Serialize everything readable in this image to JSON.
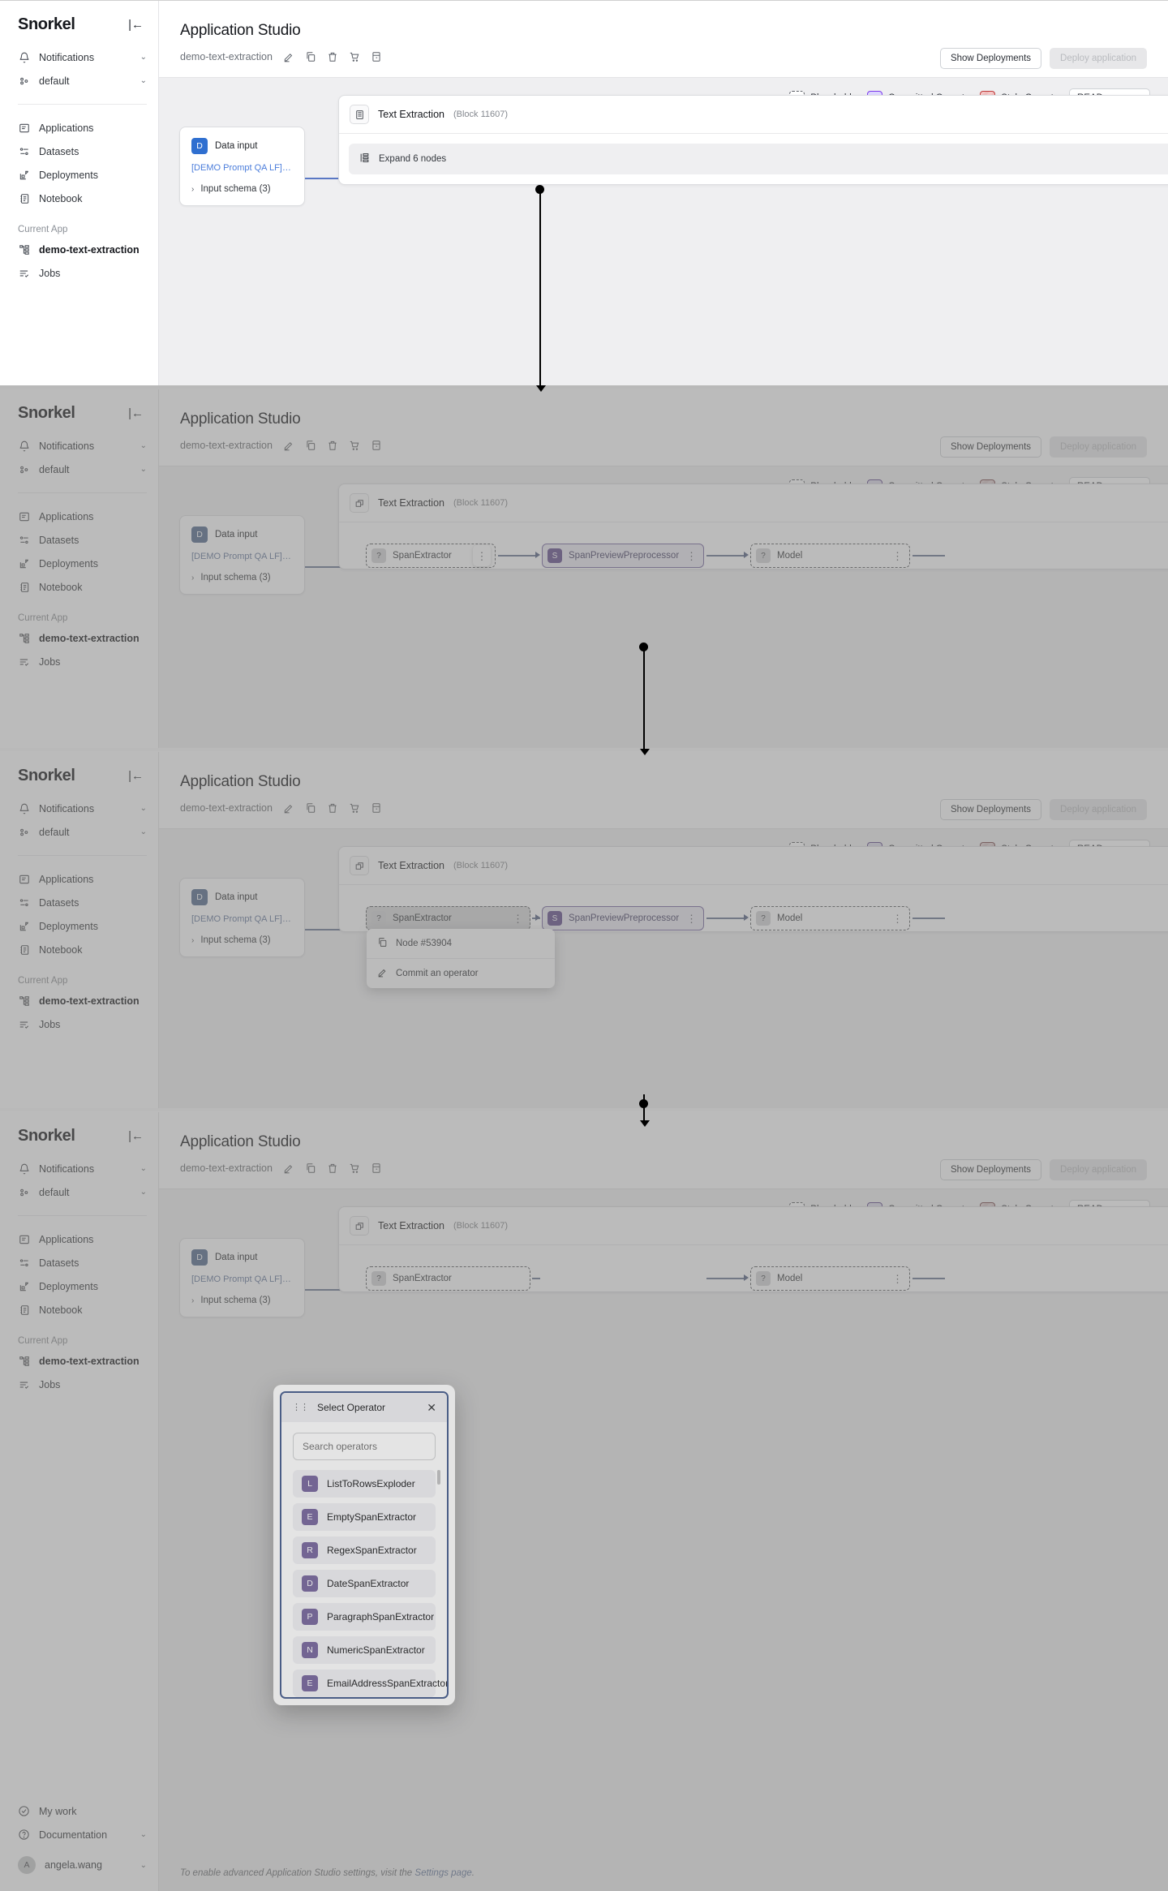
{
  "sidebar": {
    "logo": "Snorkel",
    "collapse_icon": "collapse-left-icon",
    "top_items": [
      {
        "label": "Notifications",
        "icon": "bell-icon",
        "chevron": "⌄"
      },
      {
        "label": "default",
        "icon": "workspace-icon",
        "chevron": "⌄"
      }
    ],
    "nav_items": [
      {
        "label": "Applications",
        "icon": "applications-icon"
      },
      {
        "label": "Datasets",
        "icon": "datasets-icon"
      },
      {
        "label": "Deployments",
        "icon": "deployments-icon"
      },
      {
        "label": "Notebook",
        "icon": "notebook-icon"
      }
    ],
    "current_app_caption": "Current App",
    "current_app_items": [
      {
        "label": "demo-text-extraction",
        "icon": "app-tree-icon",
        "active": true
      },
      {
        "label": "Jobs",
        "icon": "jobs-icon",
        "active": false
      }
    ],
    "bottom_items": [
      {
        "label": "My work",
        "icon": "check-circle-icon",
        "chevron": ""
      },
      {
        "label": "Documentation",
        "icon": "question-circle-icon",
        "chevron": "⌄"
      }
    ],
    "user": {
      "initial": "A",
      "name": "angela.wang",
      "chevron": "⌄"
    }
  },
  "header": {
    "title": "Application Studio",
    "app_name": "demo-text-extraction",
    "icons": [
      "edit-icon",
      "copy-icon",
      "trash-icon",
      "cart-icon",
      "archive-icon"
    ],
    "show_deployments_label": "Show Deployments",
    "deploy_label": "Deploy application"
  },
  "legend": {
    "placeholder": "Placeholder",
    "committed": "Committed Operator",
    "stale": "Stale Operator",
    "mode_value": "READ",
    "colors": {
      "committed_border": "#8b5cf6",
      "committed_fill": "#ddd6fe",
      "stale_border": "#c03a3a",
      "stale_fill": "#f4c9c9",
      "link": "#4b7ddb",
      "connector": "#5a78c4",
      "modal_accent": "#2563eb"
    }
  },
  "data_input": {
    "badge": "D",
    "title": "Data input",
    "dataset_link": "[DEMO Prompt QA LF] seq-loan-...",
    "schema_label": "Input schema (3)",
    "chevron": "›"
  },
  "block": {
    "title": "Text Extraction",
    "subtitle": "(Block 11607)",
    "icon_collapsed": "block-list-icon",
    "icon_expanded": "block-collapse-icon",
    "expand_label": "Expand 6 nodes",
    "expand_icon": "expand-nodes-icon"
  },
  "operators": [
    {
      "avatar": "?",
      "name": "SpanExtractor",
      "state": "placeholder"
    },
    {
      "avatar": "S",
      "name": "SpanPreviewPreprocessor",
      "state": "committed"
    },
    {
      "avatar": "?",
      "name": "Model",
      "state": "placeholder"
    }
  ],
  "context_menu": {
    "node_label": "Node #53904",
    "node_icon": "copy-icon",
    "commit_label": "Commit an operator",
    "commit_icon": "edit-icon"
  },
  "modal": {
    "title": "Select Operator",
    "grip_icon": "drag-grip-icon",
    "close_icon": "close-icon",
    "search_placeholder": "Search operators",
    "search_value": "",
    "items": [
      {
        "avatar": "L",
        "name": "ListToRowsExploder"
      },
      {
        "avatar": "E",
        "name": "EmptySpanExtractor"
      },
      {
        "avatar": "R",
        "name": "RegexSpanExtractor"
      },
      {
        "avatar": "D",
        "name": "DateSpanExtractor"
      },
      {
        "avatar": "P",
        "name": "ParagraphSpanExtractor"
      },
      {
        "avatar": "N",
        "name": "NumericSpanExtractor"
      },
      {
        "avatar": "E",
        "name": "EmailAddressSpanExtractor"
      }
    ]
  },
  "footer": {
    "note_prefix": "To enable advanced Application Studio settings, visit the ",
    "note_link": "Settings page",
    "note_suffix": "."
  }
}
